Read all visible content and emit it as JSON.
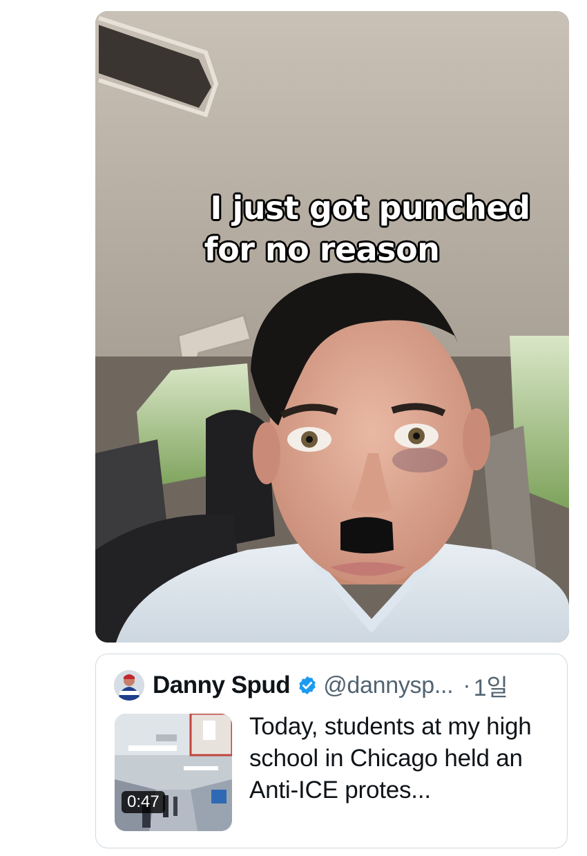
{
  "media": {
    "caption_line1": "I just got punched",
    "caption_line2": "for no reason",
    "image_description": "selfie-video-car-interior"
  },
  "quote": {
    "display_name": "Danny Spud",
    "handle": "@dannysp...",
    "separator": "·",
    "time": "1일",
    "verified_icon": "verified-badge-icon",
    "verified_color": "#1d9bf0",
    "video_duration": "0:47",
    "text": "Today, students at my high school in Chicago held an Anti-ICE protes..."
  }
}
